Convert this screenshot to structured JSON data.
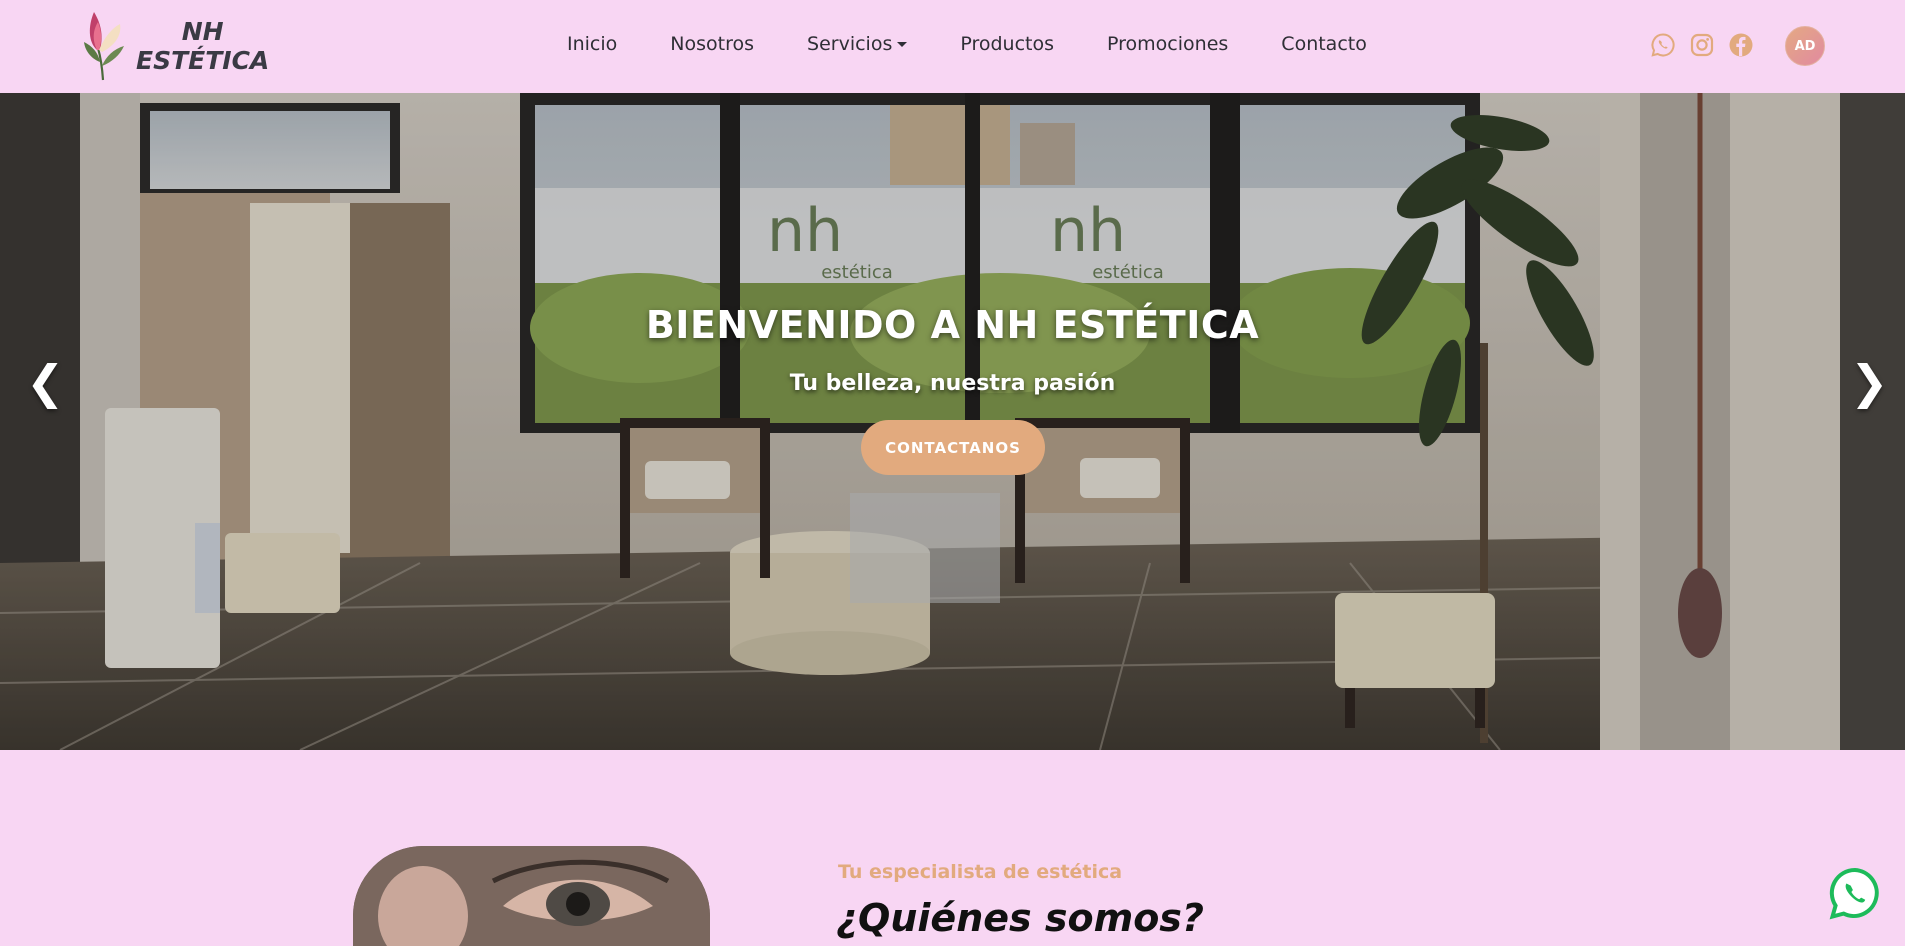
{
  "brand": {
    "line1": "NH",
    "line2": "ESTÉTICA"
  },
  "nav": {
    "items": [
      {
        "label": "Inicio"
      },
      {
        "label": "Nosotros"
      },
      {
        "label": "Servicios",
        "dropdown": true
      },
      {
        "label": "Productos"
      },
      {
        "label": "Promociones"
      },
      {
        "label": "Contacto"
      }
    ]
  },
  "socials": [
    "whatsapp-icon",
    "instagram-icon",
    "facebook-icon"
  ],
  "user": {
    "initials": "AD"
  },
  "hero": {
    "title": "BIENVENIDO A NH ESTÉTICA",
    "subtitle": "Tu belleza, nuestra pasión",
    "button": "CONTACTANOS",
    "prev": "❮",
    "next": "❯",
    "window_text_1": "nh",
    "window_text_1b": "estética",
    "window_text_2": "nh",
    "window_text_2b": "estética"
  },
  "about": {
    "kicker": "Tu especialista de estética",
    "title": "¿Quiénes somos?"
  },
  "colors": {
    "background": "#f8d6f3",
    "accent": "#e2aa7e",
    "text": "#2f2f36"
  }
}
